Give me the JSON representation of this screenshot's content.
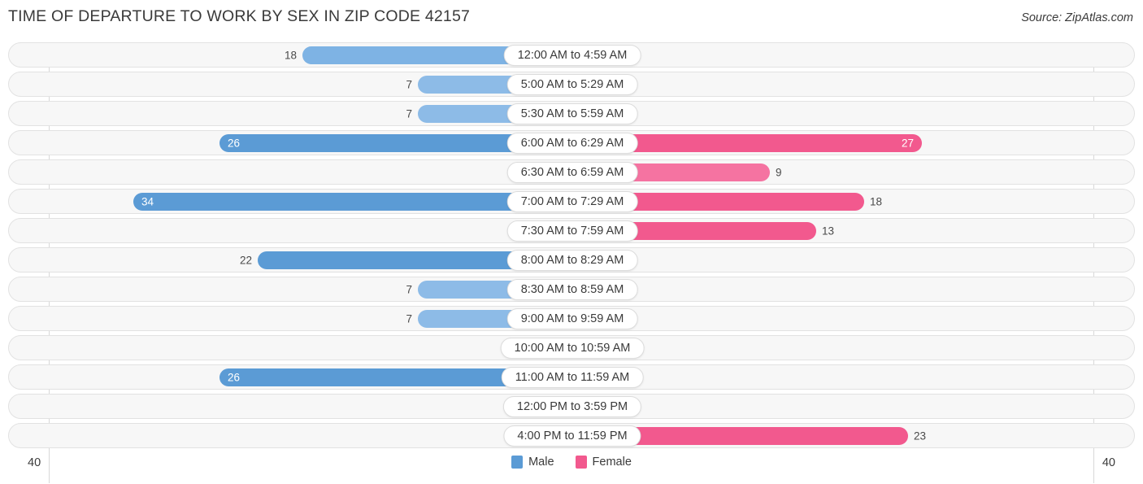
{
  "header": {
    "title": "TIME OF DEPARTURE TO WORK BY SEX IN ZIP CODE 42157",
    "source": "Source: ZipAtlas.com"
  },
  "axis": {
    "left_label": "40",
    "right_label": "40"
  },
  "legend": [
    {
      "label": "Male",
      "color": "#5b9bd5"
    },
    {
      "label": "Female",
      "color": "#f2598e"
    }
  ],
  "palette": {
    "male_strong": "#5b9bd5",
    "male_mid": "#7eb3e4",
    "male_light": "#a9cbee",
    "female_strong": "#f2598e",
    "female_mid": "#f573a1",
    "female_light": "#f9a8c4",
    "row_bg": "#f7f7f7",
    "row_border": "#e2e2e2",
    "gridline": "#d8d8d8"
  },
  "chart_data": {
    "type": "bar",
    "subtype": "diverging-horizontal",
    "title": "TIME OF DEPARTURE TO WORK BY SEX IN ZIP CODE 42157",
    "xlabel": "",
    "ylabel": "",
    "xlim": [
      40,
      40
    ],
    "grid": true,
    "legend_position": "bottom-center",
    "categories": [
      "12:00 AM to 4:59 AM",
      "5:00 AM to 5:29 AM",
      "5:30 AM to 5:59 AM",
      "6:00 AM to 6:29 AM",
      "6:30 AM to 6:59 AM",
      "7:00 AM to 7:29 AM",
      "7:30 AM to 7:59 AM",
      "8:00 AM to 8:29 AM",
      "8:30 AM to 8:59 AM",
      "9:00 AM to 9:59 AM",
      "10:00 AM to 10:59 AM",
      "11:00 AM to 11:59 AM",
      "12:00 PM to 3:59 PM",
      "4:00 PM to 11:59 PM"
    ],
    "series": [
      {
        "name": "Male",
        "values": [
          18,
          7,
          7,
          26,
          0,
          34,
          0,
          22,
          7,
          7,
          0,
          26,
          0,
          0
        ]
      },
      {
        "name": "Female",
        "values": [
          0,
          0,
          0,
          27,
          9,
          18,
          13,
          0,
          0,
          0,
          0,
          0,
          0,
          23
        ]
      }
    ]
  },
  "rows": [
    {
      "category": "12:00 AM to 4:59 AM",
      "male": "18",
      "male_w": 330,
      "male_color": "#7eb3e4",
      "male_inside": false,
      "female": "0",
      "female_w": 55,
      "female_color": "#f9a8c4",
      "female_inside": false
    },
    {
      "category": "5:00 AM to 5:29 AM",
      "male": "7",
      "male_w": 188,
      "male_color": "#8dbbe7",
      "male_inside": false,
      "female": "0",
      "female_w": 55,
      "female_color": "#f9a8c4",
      "female_inside": false
    },
    {
      "category": "5:30 AM to 5:59 AM",
      "male": "7",
      "male_w": 188,
      "male_color": "#8dbbe7",
      "male_inside": false,
      "female": "0",
      "female_w": 55,
      "female_color": "#f9a8c4",
      "female_inside": false
    },
    {
      "category": "6:00 AM to 6:29 AM",
      "male": "26",
      "male_w": 432,
      "male_color": "#5b9bd5",
      "male_inside": true,
      "female": "27",
      "female_w": 430,
      "female_color": "#f2598e",
      "female_inside": true
    },
    {
      "category": "6:30 AM to 6:59 AM",
      "male": "0",
      "male_w": 55,
      "male_color": "#a9cbee",
      "male_inside": false,
      "female": "9",
      "female_w": 243,
      "female_color": "#f573a1",
      "female_inside": false
    },
    {
      "category": "7:00 AM to 7:29 AM",
      "male": "34",
      "male_w": 538,
      "male_color": "#5b9bd5",
      "male_inside": true,
      "female": "18",
      "female_w": 359,
      "female_color": "#f2598e",
      "female_inside": false
    },
    {
      "category": "7:30 AM to 7:59 AM",
      "male": "0",
      "male_w": 55,
      "male_color": "#a9cbee",
      "male_inside": false,
      "female": "13",
      "female_w": 300,
      "female_color": "#f2598e",
      "female_inside": false
    },
    {
      "category": "8:00 AM to 8:29 AM",
      "male": "22",
      "male_w": 385,
      "male_color": "#5b9bd5",
      "male_inside": false,
      "female": "0",
      "female_w": 55,
      "female_color": "#f9a8c4",
      "female_inside": false
    },
    {
      "category": "8:30 AM to 8:59 AM",
      "male": "7",
      "male_w": 188,
      "male_color": "#8dbbe7",
      "male_inside": false,
      "female": "0",
      "female_w": 55,
      "female_color": "#f9a8c4",
      "female_inside": false
    },
    {
      "category": "9:00 AM to 9:59 AM",
      "male": "7",
      "male_w": 188,
      "male_color": "#8dbbe7",
      "male_inside": false,
      "female": "0",
      "female_w": 55,
      "female_color": "#f9a8c4",
      "female_inside": false
    },
    {
      "category": "10:00 AM to 10:59 AM",
      "male": "0",
      "male_w": 55,
      "male_color": "#a9cbee",
      "male_inside": false,
      "female": "0",
      "female_w": 55,
      "female_color": "#f9a8c4",
      "female_inside": false
    },
    {
      "category": "11:00 AM to 11:59 AM",
      "male": "26",
      "male_w": 432,
      "male_color": "#5b9bd5",
      "male_inside": true,
      "female": "0",
      "female_w": 55,
      "female_color": "#f9a8c4",
      "female_inside": false
    },
    {
      "category": "12:00 PM to 3:59 PM",
      "male": "0",
      "male_w": 55,
      "male_color": "#a9cbee",
      "male_inside": false,
      "female": "0",
      "female_w": 55,
      "female_color": "#f9a8c4",
      "female_inside": false
    },
    {
      "category": "4:00 PM to 11:59 PM",
      "male": "0",
      "male_w": 55,
      "male_color": "#a9cbee",
      "male_inside": false,
      "female": "23",
      "female_w": 413,
      "female_color": "#f2598e",
      "female_inside": false
    }
  ]
}
